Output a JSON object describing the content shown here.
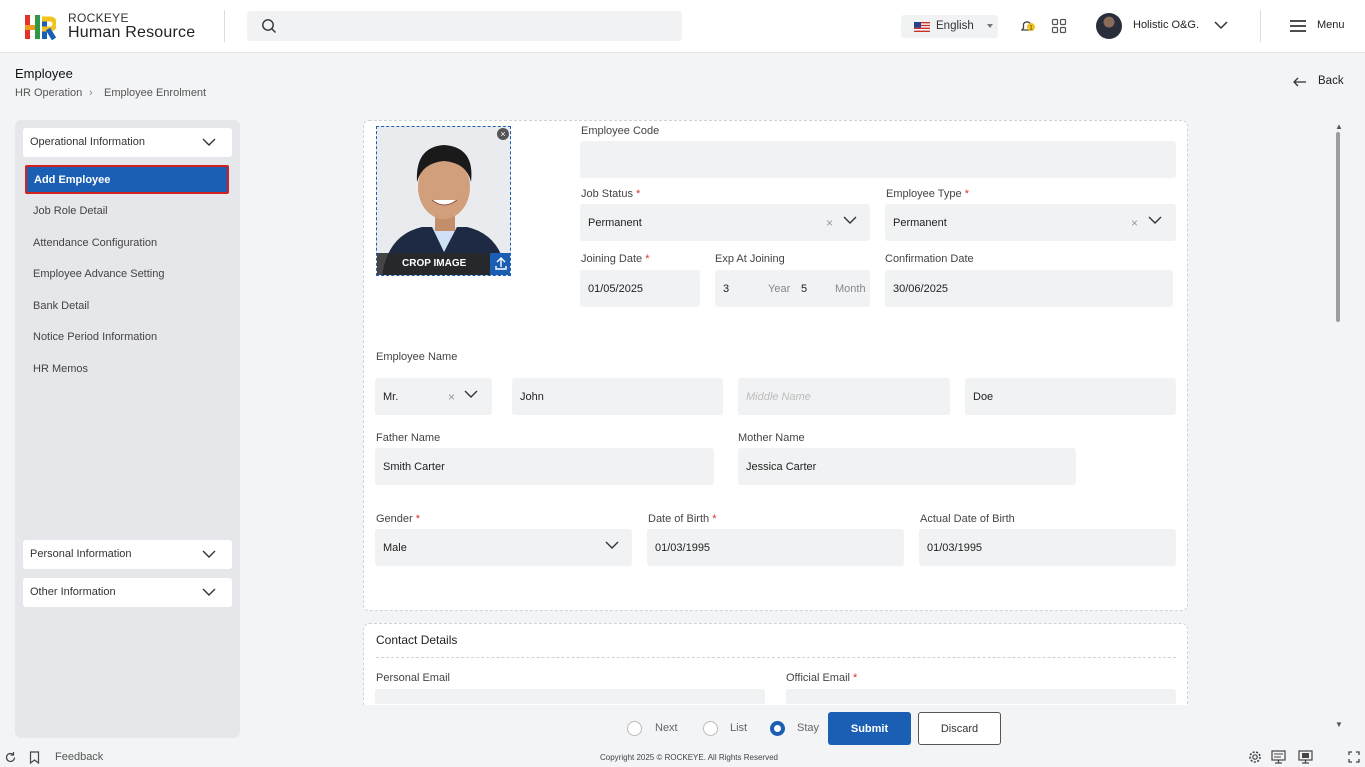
{
  "header": {
    "brand_small": "ROCKEYE",
    "brand_big": "Human Resource",
    "language": "English",
    "user_name": "Holistic O&G.",
    "menu_label": "Menu",
    "notification_count": "1"
  },
  "page": {
    "title": "Employee",
    "breadcrumb": [
      "HR Operation",
      "Employee Enrolment"
    ],
    "back_label": "Back"
  },
  "sidebar": {
    "sections": [
      {
        "label": "Operational Information"
      },
      {
        "label": "Personal Information"
      },
      {
        "label": "Other Information"
      }
    ],
    "active_item": "Add Employee",
    "items": [
      "Job Role Detail",
      "Attendance Configuration",
      "Employee Advance Setting",
      "Bank Detail",
      "Notice Period Information",
      "HR Memos"
    ]
  },
  "form": {
    "crop_label": "CROP IMAGE",
    "employee_code_label": "Employee Code",
    "employee_code": "",
    "job_status_label": "Job Status",
    "job_status": "Permanent",
    "employee_type_label": "Employee Type",
    "employee_type": "Permanent",
    "joining_date_label": "Joining Date",
    "joining_date": "01/05/2025",
    "exp_label": "Exp At Joining",
    "exp_year": "3",
    "exp_year_unit": "Year",
    "exp_month": "5",
    "exp_month_unit": "Month",
    "confirmation_label": "Confirmation Date",
    "confirmation_date": "30/06/2025",
    "employee_name_label": "Employee Name",
    "salutation": "Mr.",
    "first_name": "John",
    "middle_placeholder": "Middle Name",
    "last_name": "Doe",
    "father_label": "Father Name",
    "father_name": "Smith Carter",
    "mother_label": "Mother Name",
    "mother_name": "Jessica Carter",
    "gender_label": "Gender",
    "gender": "Male",
    "dob_label": "Date of Birth",
    "dob": "01/03/1995",
    "actual_dob_label": "Actual Date of Birth",
    "actual_dob": "01/03/1995",
    "required_mark": "*"
  },
  "contact": {
    "title": "Contact Details",
    "personal_email_label": "Personal Email",
    "official_email_label": "Official Email"
  },
  "actions": {
    "next_label": "Next",
    "list_label": "List",
    "stay_label": "Stay",
    "selected": "Stay",
    "submit_label": "Submit",
    "discard_label": "Discard"
  },
  "footer": {
    "feedback_label": "Feedback",
    "copyright": "Copyright 2025 © ROCKEYE. All Rights Reserved"
  },
  "colors": {
    "primary": "#1b5fb4",
    "required": "#d9342b",
    "highlight_border": "#d32020"
  }
}
